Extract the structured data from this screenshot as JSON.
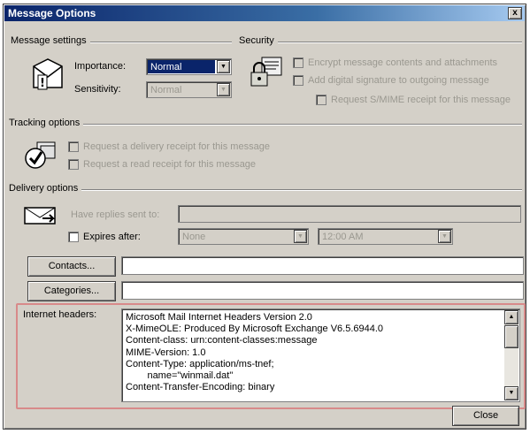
{
  "window": {
    "title": "Message Options",
    "close_glyph": "x"
  },
  "message_settings": {
    "label": "Message settings",
    "importance_label": "Importance:",
    "importance_value": "Normal",
    "sensitivity_label": "Sensitivity:",
    "sensitivity_value": "Normal"
  },
  "security": {
    "label": "Security",
    "encrypt_label": "Encrypt message contents and attachments",
    "signature_label": "Add digital signature to outgoing message",
    "smime_label": "Request S/MIME receipt for this message"
  },
  "tracking": {
    "label": "Tracking options",
    "delivery_receipt_label": "Request a delivery receipt for this message",
    "read_receipt_label": "Request a read receipt for this message"
  },
  "delivery": {
    "label": "Delivery options",
    "replies_label": "Have replies sent to:",
    "expires_label": "Expires after:",
    "expires_date": "None",
    "expires_time": "12:00 AM"
  },
  "contacts_button": "Contacts...",
  "categories_button": "Categories...",
  "internet_headers": {
    "label": "Internet headers:",
    "lines": [
      "Microsoft Mail Internet Headers Version 2.0",
      "X-MimeOLE: Produced By Microsoft Exchange V6.5.6944.0",
      "Content-class: urn:content-classes:message",
      "MIME-Version: 1.0",
      "Content-Type: application/ms-tnef;",
      "        name=\"winmail.dat\"",
      "Content-Transfer-Encoding: binary"
    ]
  },
  "close_button": "Close",
  "icons": {
    "message_settings": "envelope-priority-icon",
    "security": "lock-key-icon",
    "tracking": "checkmark-envelope-icon",
    "delivery": "delivery-envelope-icon"
  }
}
